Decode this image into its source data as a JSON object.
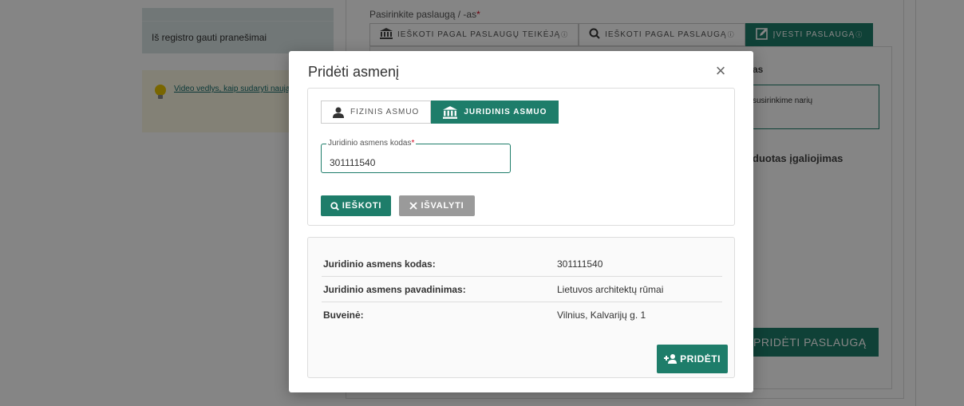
{
  "background": {
    "sidebar_item": "Iš registro gauti pranešimai",
    "tip_link": "Video vedlys, kaip sudaryti naują įgaliojimą",
    "select_label": "Pasirinkite paslaugą / -as",
    "required_mark": "*",
    "tabs": [
      {
        "label": "IEŠKOTI PAGAL PASLAUGŲ TEIKĖJĄ",
        "info": "ⓘ"
      },
      {
        "label": "IEŠKOTI PAGAL PASLAUGĄ",
        "info": "ⓘ"
      },
      {
        "label": "ĮVESTI PASLAUGĄ",
        "info": "ⓘ"
      }
    ],
    "text_as": "as",
    "green_box_text": "susirinkime narių",
    "text_igaliojimas": "duotas įgaliojimas",
    "add_service_label": "PRIDĖTI PASLAUGĄ"
  },
  "modal": {
    "title": "Pridėti asmenį",
    "close_icon": "×",
    "type_tabs": {
      "physical_label": "FIZINIS ASMUO",
      "legal_label": "JURIDINIS ASMUO",
      "active": "legal"
    },
    "code_field": {
      "label": "Juridinio asmens kodas",
      "required_mark": "*",
      "value": "301111540"
    },
    "search_label": "IEŠKOTI",
    "clear_label": "IŠVALYTI",
    "results": [
      {
        "key": "Juridinio asmens kodas:",
        "value": "301111540"
      },
      {
        "key": "Juridinio asmens pavadinimas:",
        "value": "Lietuvos architektų rūmai"
      },
      {
        "key": "Buveinė:",
        "value": "Vilnius, Kalvarijų g. 1"
      }
    ],
    "add_label": "PRIDĖTI"
  },
  "colors": {
    "primary": "#1e7d6a",
    "secondary": "#9a9a9a",
    "overlay": "rgba(0,0,0,0.48)"
  }
}
